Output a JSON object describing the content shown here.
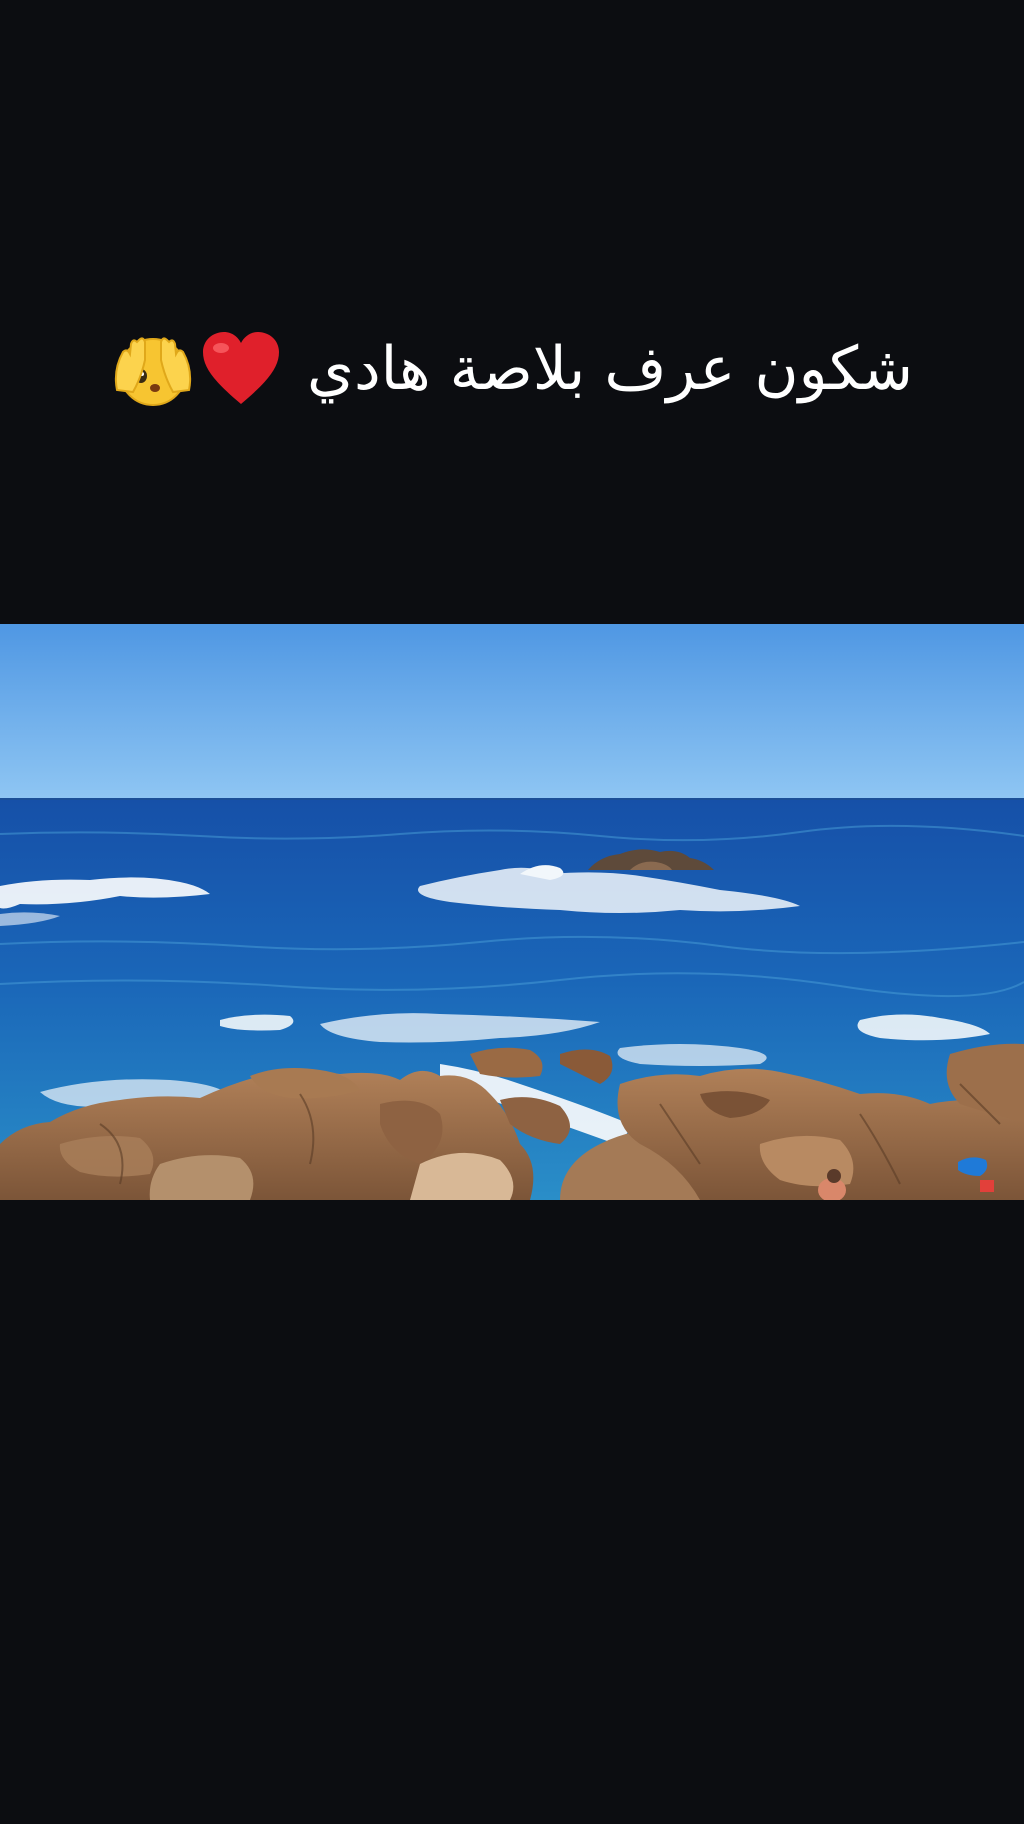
{
  "caption": {
    "text": "شكون عرف بلاصة هادي",
    "emojis": [
      "heart-icon",
      "face-peeking-hands-icon"
    ]
  },
  "video": {
    "scene": "sea-with-rocks",
    "colors": {
      "sky_top": "#4f97e3",
      "sky_bottom": "#8fc6f3",
      "sea_deep": "#1a66b8",
      "sea_light": "#2a8ec8",
      "foam": "#f2f7fb",
      "rock": "#9c6f4b",
      "rock_dark": "#6b4a33",
      "background": "#0c0d11"
    }
  }
}
